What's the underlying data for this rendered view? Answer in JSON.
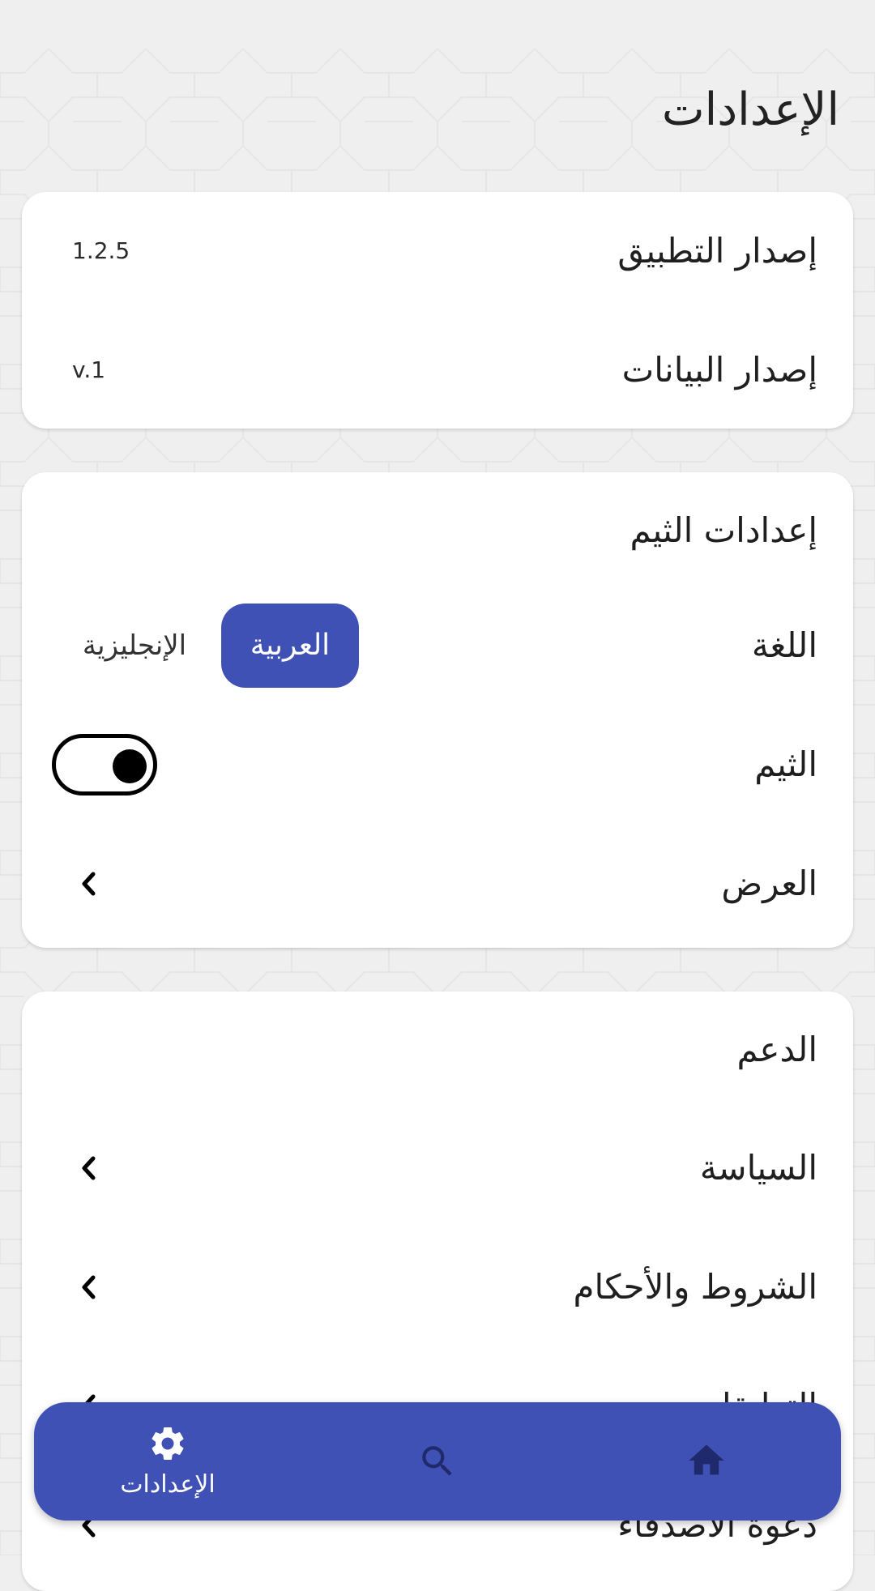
{
  "page": {
    "title": "الإعدادات"
  },
  "versions": {
    "app_version_label": "إصدار التطبيق",
    "app_version_value": "1.2.5",
    "data_version_label": "إصدار البيانات",
    "data_version_value": "v.1"
  },
  "theme_settings": {
    "title": "إعدادات الثيم",
    "language_label": "اللغة",
    "language_options": [
      "العربية",
      "الإنجليزية"
    ],
    "language_selected": "العربية",
    "theme_label": "الثيم",
    "theme_toggle_on": true,
    "display_label": "العرض"
  },
  "support": {
    "title": "الدعم",
    "items": [
      {
        "label": "السياسة"
      },
      {
        "label": "الشروط والأحكام"
      },
      {
        "label": "التعليقات"
      },
      {
        "label": "دعوة الأصدقاء"
      }
    ]
  },
  "bottom_nav": {
    "items": [
      {
        "icon": "gear-icon",
        "label": "الإعدادات",
        "active": true
      },
      {
        "icon": "search-icon",
        "label": ""
      },
      {
        "icon": "home-icon",
        "label": ""
      }
    ]
  },
  "colors": {
    "accent": "#3f51b5",
    "background": "#efefef",
    "card": "#ffffff",
    "inactive_icon": "#1e2a6b"
  }
}
